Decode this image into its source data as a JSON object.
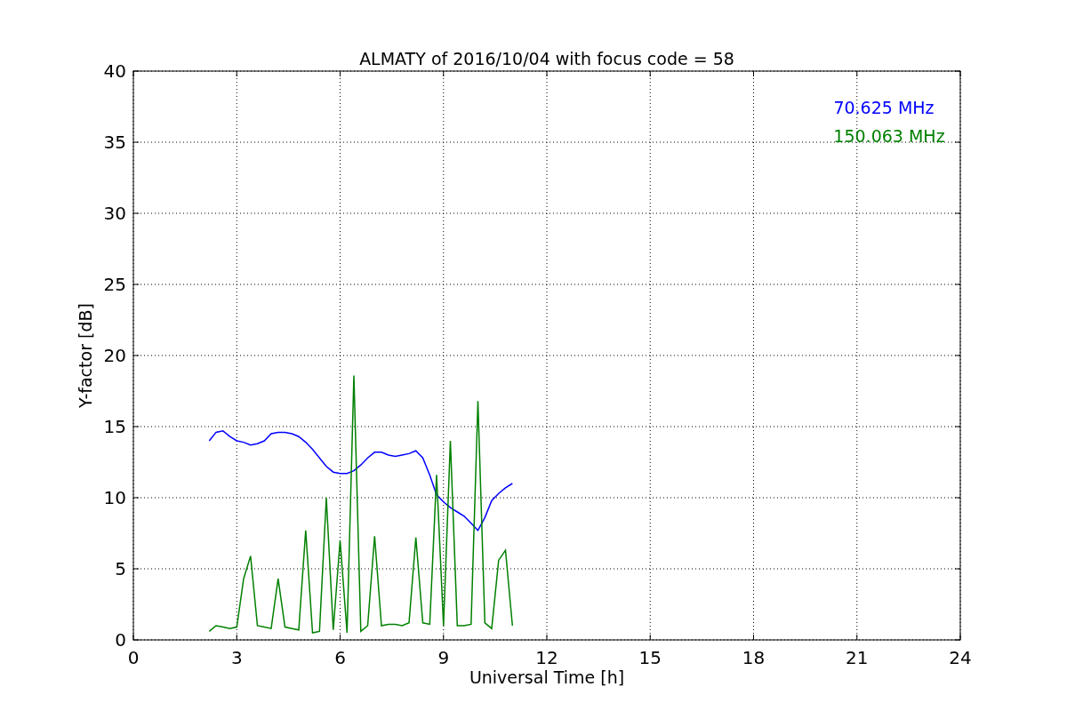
{
  "figure": {
    "chart_data": {
      "type": "line",
      "title": "ALMATY of 2016/10/04 with focus code = 58",
      "xlabel": "Universal Time [h]",
      "ylabel": "Y-factor [dB]",
      "grid": true,
      "xlim": [
        0,
        24
      ],
      "ylim": [
        0,
        40
      ],
      "xticks": [
        0,
        3,
        6,
        9,
        12,
        15,
        18,
        21,
        24
      ],
      "yticks": [
        0,
        5,
        10,
        15,
        20,
        25,
        30,
        35,
        40
      ],
      "x": [
        2.2,
        2.4,
        2.6,
        2.8,
        3.0,
        3.2,
        3.4,
        3.6,
        3.8,
        4.0,
        4.2,
        4.4,
        4.6,
        4.8,
        5.0,
        5.2,
        5.4,
        5.6,
        5.8,
        6.0,
        6.2,
        6.4,
        6.6,
        6.8,
        7.0,
        7.2,
        7.4,
        7.6,
        7.8,
        8.0,
        8.2,
        8.4,
        8.6,
        8.8,
        9.0,
        9.2,
        9.4,
        9.6,
        9.8,
        10.0,
        10.2,
        10.4,
        10.6,
        10.8,
        11.0
      ],
      "series": [
        {
          "name": "70.625 MHz",
          "color": "#0000ff",
          "values": [
            14.0,
            14.6,
            14.7,
            14.3,
            14.0,
            13.9,
            13.7,
            13.8,
            14.0,
            14.5,
            14.6,
            14.6,
            14.5,
            14.3,
            13.9,
            13.4,
            12.8,
            12.2,
            11.8,
            11.7,
            11.7,
            11.9,
            12.3,
            12.8,
            13.2,
            13.2,
            13.0,
            12.9,
            13.0,
            13.1,
            13.3,
            12.8,
            11.6,
            10.2,
            9.7,
            9.3,
            9.0,
            8.7,
            8.2,
            7.7,
            8.6,
            9.8,
            10.3,
            10.7,
            11.0
          ]
        },
        {
          "name": "150.063 MHz",
          "color": "#008000",
          "values": [
            0.6,
            1.0,
            0.9,
            0.8,
            0.9,
            4.3,
            5.9,
            1.0,
            0.9,
            0.8,
            4.3,
            0.9,
            0.8,
            0.7,
            7.7,
            0.5,
            0.6,
            10.0,
            0.7,
            7.0,
            0.5,
            18.6,
            0.6,
            1.0,
            7.3,
            1.0,
            1.1,
            1.1,
            1.0,
            1.2,
            7.2,
            1.2,
            1.1,
            11.6,
            1.0,
            14.0,
            1.0,
            1.0,
            1.1,
            16.8,
            1.2,
            0.8,
            5.6,
            6.3,
            1.0
          ]
        }
      ]
    }
  }
}
